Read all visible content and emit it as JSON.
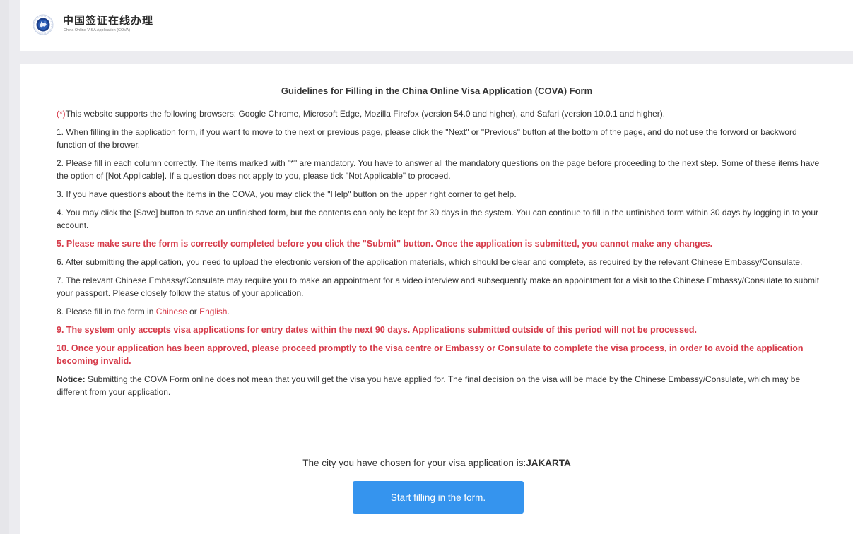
{
  "header": {
    "brand_cn": "中国签证在线办理",
    "brand_en": "China Online VISA Application (COVA)",
    "logo_icon": "cova-logo-icon"
  },
  "guide": {
    "title": "Guidelines for Filling in the China Online Visa Application (COVA) Form",
    "intro_mark": "(*)",
    "intro": "This website supports the following browsers: Google Chrome, Microsoft Edge, Mozilla Firefox (version 54.0 and higher), and Safari (version 10.0.1 and higher).",
    "item1": "1. When filling in the application form, if you want to move to the next or previous page, please click the \"Next\" or \"Previous\" button at the bottom of the page, and do not use the forword or backword function of the brower.",
    "item2": "2. Please fill in each column correctly. The items marked with \"*\" are mandatory. You have to answer all the mandatory questions on the page before proceeding to the next step. Some of these items have the option of [Not Applicable]. If a question does not apply to you, please tick \"Not Applicable\" to proceed.",
    "item3": "3. If you have questions about the items in the COVA, you may click the \"Help\" button on the upper right corner to get help.",
    "item4": "4. You may click the [Save] button to save an unfinished form, but the contents can only be kept for 30 days in the system. You can continue to fill in the unfinished form within 30 days by logging in to your account.",
    "item5": "5. Please make sure the form is correctly completed before you click the \"Submit\" button. Once the application is submitted, you cannot make any changes.",
    "item6": "6. After submitting the application, you need to upload the electronic version of the application materials, which should be clear and complete, as required by the relevant Chinese Embassy/Consulate.",
    "item7": "7. The relevant Chinese Embassy/Consulate may require you to make an appointment for a video interview and subsequently make an appointment for a visit to the Chinese Embassy/Consulate to submit your passport. Please closely follow the status of your application.",
    "item8_prefix": "8. Please fill in the form in ",
    "item8_chinese": "Chinese",
    "item8_or": " or ",
    "item8_english": "English",
    "item8_suffix": ".",
    "item9": "9. The system only accepts visa applications for entry dates within the next 90 days. Applications submitted outside of this period will not be processed.",
    "item10": "10. Once your application has been approved, please proceed promptly to the visa centre or Embassy or Consulate to complete the visa process, in order to avoid the application becoming invalid.",
    "notice_label": "Notice:",
    "notice_text": " Submitting the COVA Form online does not mean that you will get the visa you have applied for. The final decision on the visa will be made by the Chinese Embassy/Consulate, which may be different from your application."
  },
  "city": {
    "label": "The city you have chosen for your visa application is:",
    "value": "JAKARTA"
  },
  "actions": {
    "start_label": "Start filling in the form."
  },
  "colors": {
    "accent_blue": "#3594ee",
    "warning_red": "#d63b4a"
  }
}
